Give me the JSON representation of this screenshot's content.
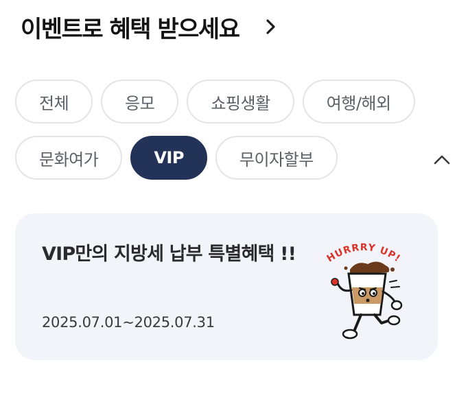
{
  "header": {
    "title": "이벤트로 혜택 받으세요",
    "more_icon": "chevron-right-icon"
  },
  "filters": {
    "row1": [
      "전체",
      "응모",
      "쇼핑생활",
      "여행/해외"
    ],
    "row2": [
      "문화여가",
      "VIP",
      "무이자할부"
    ],
    "selected": "VIP",
    "collapse_icon": "chevron-up-icon"
  },
  "event_card": {
    "title": "VIP만의 지방세 납부 특별혜택 !!",
    "date": "2025.07.01~2025.07.31",
    "image_text": "HURRRY UP!",
    "image_icon": "running-coffee-cup-illustration"
  },
  "colors": {
    "selected_chip": "#233357",
    "card_background": "#f3f4f9",
    "chip_border": "#e3e4e8"
  }
}
